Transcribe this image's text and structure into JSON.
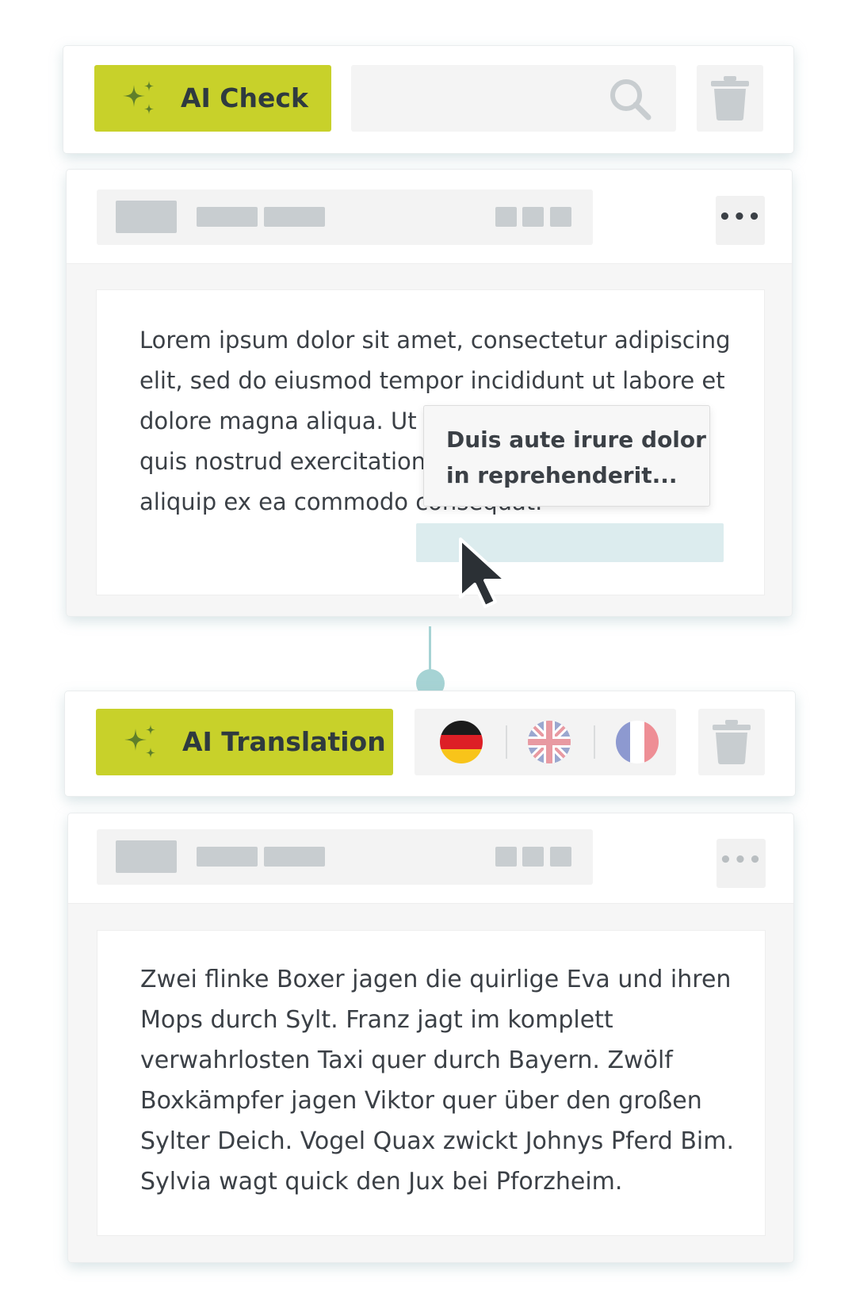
{
  "ai_check_toolbar": {
    "button_label": "AI Check",
    "button_icon": "sparkle-icon",
    "search": {
      "value": "",
      "placeholder": "",
      "icon": "search-icon"
    },
    "delete_icon": "trash-icon"
  },
  "source_card": {
    "more_label": "•••",
    "text": "Lorem ipsum dolor sit amet, consectetur adipiscing elit, sed do eiusmod tempor incididunt ut labore et dolore magna aliqua. Ut enim ad minim veniam, quis nostrud exercitation ullamco laboris nisi ut aliquip ex ea commodo consequat.",
    "suggestion_tooltip": {
      "line1": "Duis aute irure dolor",
      "line2": "in reprehenderit..."
    }
  },
  "ai_translation_toolbar": {
    "button_label": "AI Translation",
    "button_icon": "sparkle-icon",
    "languages": [
      {
        "code": "de",
        "icon": "german-flag-icon"
      },
      {
        "code": "gb",
        "icon": "uk-flag-icon"
      },
      {
        "code": "fr",
        "icon": "french-flag-icon"
      }
    ],
    "delete_icon": "trash-icon"
  },
  "translation_card": {
    "more_label": "•••",
    "text": "Zwei flinke Boxer jagen die quirlige Eva und ihren Mops durch Sylt. Franz jagt im komplett verwahrlosten Taxi quer durch Bayern. Zwölf Boxkämpfer jagen Viktor quer über den großen Sylter Deich. Vogel Quax zwickt Johnys Pferd Bim. Sylvia wagt quick den Jux bei Pforzheim."
  },
  "colors": {
    "accent": "#c8d12a",
    "connector": "#a6d3d4",
    "highlight": "#dcecee",
    "skeleton": "#c8cdd0",
    "text": "#3b4046"
  }
}
